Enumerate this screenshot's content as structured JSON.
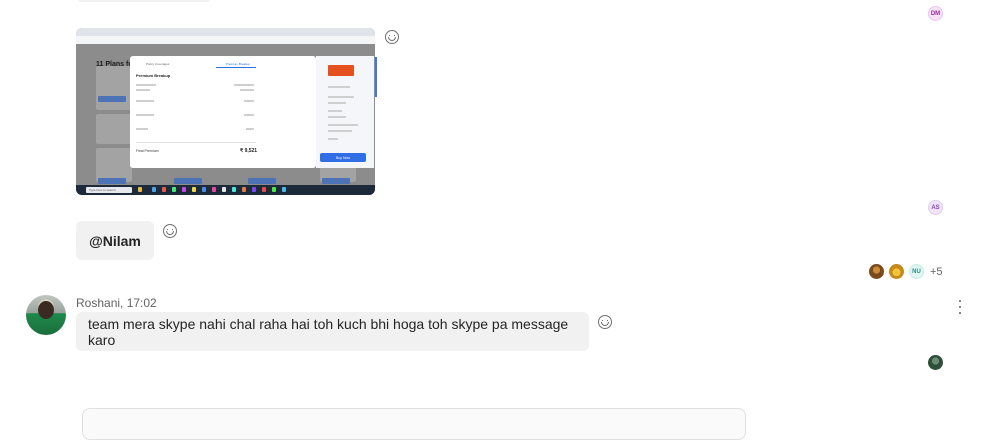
{
  "messages": [
    {
      "type": "image",
      "alt": "screenshot"
    },
    {
      "type": "text",
      "mention": "@Nilam"
    },
    {
      "sender": "Roshani",
      "time": "17:02",
      "sender_line": "Roshani, 17:02",
      "text": "team mera skype nahi chal raha hai toh kuch bhi hoga toh skype pa message karo"
    }
  ],
  "read_receipts": {
    "top": "DM",
    "second": "AS",
    "group": {
      "initials": "NU",
      "extra_count": "+5"
    }
  },
  "screenshot": {
    "heading": "11 Plans found",
    "modal_tabs": [
      "Policy Coverages",
      "Premium Breakup"
    ],
    "modal_title": "Premium Breakup",
    "final_label": "Final Premium",
    "final_value": "₹ 9,521",
    "buy_label": "Buy Now",
    "taskbar_search": "Type here to search"
  },
  "colors": {
    "bubble": "#f1f1f1",
    "accent": "#2f6ee5"
  }
}
